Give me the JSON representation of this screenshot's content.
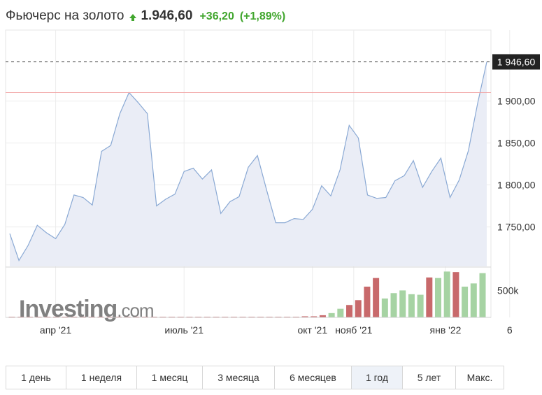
{
  "header": {
    "title": "Фьючерс на золото",
    "price": "1.946,60",
    "change": "+36,20",
    "change_pct": "(+1,89%)",
    "up_color": "#41a62e"
  },
  "watermark": "Investing.com",
  "price_tag": "1 946,60",
  "volume_tick": "500k",
  "tabs": [
    {
      "label": "1 день",
      "active": false
    },
    {
      "label": "1 неделя",
      "active": false
    },
    {
      "label": "1 месяц",
      "active": false
    },
    {
      "label": "3 месяца",
      "active": false
    },
    {
      "label": "6 месяцев",
      "active": false
    },
    {
      "label": "1 год",
      "active": true
    },
    {
      "label": "5 лет",
      "active": false
    },
    {
      "label": "Макс.",
      "active": false
    }
  ],
  "chart_data": {
    "type": "area",
    "y_ticks": [
      "1 900,00",
      "1 850,00",
      "1 800,00",
      "1 750,00"
    ],
    "y_tick_values": [
      1900,
      1850,
      1800,
      1750
    ],
    "ylim": [
      1703,
      1962
    ],
    "x_labels": [
      "апр '21",
      "июль '21",
      "окт '21",
      "нояб '21",
      "янв '22",
      "6"
    ],
    "x_label_positions": [
      5,
      19,
      33,
      37.5,
      47.5,
      54.5
    ],
    "last_price": 1946.6,
    "reference_level": 1910,
    "series": [
      {
        "values": [
          1742,
          1710,
          1728,
          1752,
          1743,
          1736,
          1753,
          1788,
          1785,
          1776,
          1840,
          1847,
          1885,
          1910,
          1898,
          1885,
          1775,
          1783,
          1789,
          1816,
          1820,
          1807,
          1818,
          1766,
          1780,
          1786,
          1821,
          1835,
          1794,
          1755,
          1755,
          1760,
          1759,
          1771,
          1799,
          1787,
          1818,
          1871,
          1856,
          1788,
          1784,
          1785,
          1805,
          1811,
          1829,
          1797,
          1816,
          1832,
          1785,
          1806,
          1841,
          1897,
          1946.6
        ]
      }
    ],
    "volume": {
      "tick": 500000,
      "values": [
        2000,
        2000,
        2000,
        2000,
        2000,
        2000,
        2000,
        2000,
        2000,
        2000,
        2000,
        2000,
        2000,
        2000,
        2000,
        2000,
        2000,
        2000,
        2000,
        2000,
        3000,
        3000,
        3000,
        3000,
        3000,
        3000,
        3000,
        3000,
        3000,
        3000,
        10000,
        10000,
        10000,
        20000,
        20000,
        40000,
        80000,
        160000,
        230000,
        320000,
        570000,
        730000,
        350000,
        450000,
        500000,
        430000,
        420000,
        740000,
        730000,
        850000,
        840000,
        570000,
        630000,
        820000
      ],
      "direction": [
        "d",
        "d",
        "d",
        "d",
        "d",
        "d",
        "d",
        "d",
        "d",
        "d",
        "d",
        "d",
        "d",
        "d",
        "d",
        "d",
        "d",
        "d",
        "d",
        "d",
        "d",
        "d",
        "d",
        "d",
        "d",
        "d",
        "d",
        "d",
        "d",
        "d",
        "d",
        "d",
        "d",
        "d",
        "d",
        "d",
        "u",
        "u",
        "d",
        "d",
        "d",
        "d",
        "u",
        "u",
        "u",
        "u",
        "u",
        "d",
        "u",
        "u",
        "d",
        "u",
        "u",
        "u"
      ],
      "up_color": "#a6d3a3",
      "down_color": "#c8696b"
    },
    "colors": {
      "line": "#8aa9d4",
      "fill": "#eaedf6",
      "reference": "#f2a3a3",
      "grid": "#ececec"
    }
  }
}
